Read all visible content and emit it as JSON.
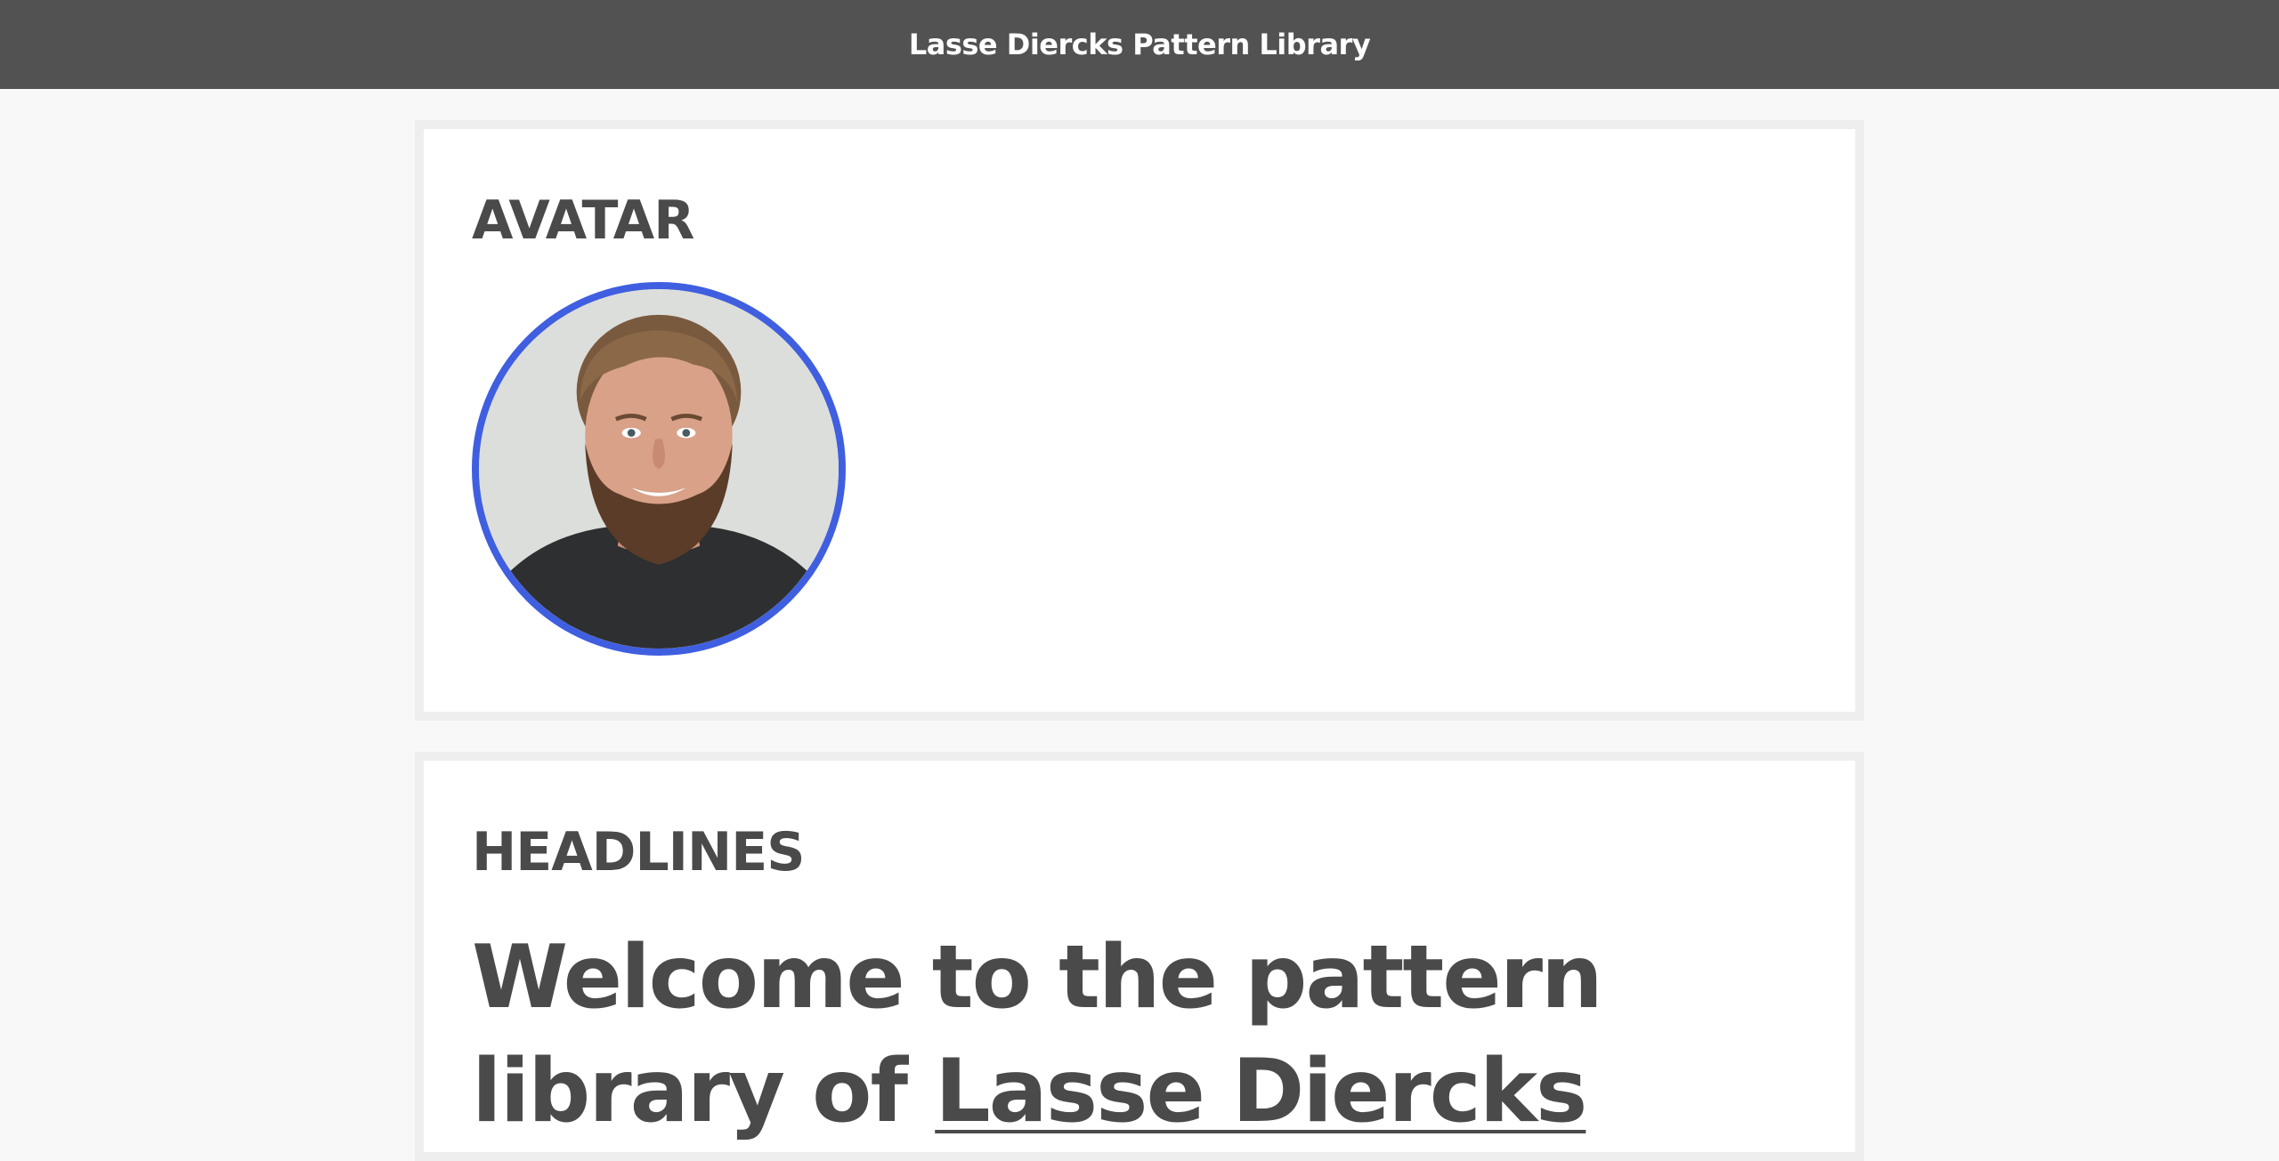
{
  "header": {
    "title": "Lasse Diercks Pattern Library"
  },
  "avatar_section": {
    "title": "AVATAR",
    "avatar_alt": "Lasse Diercks",
    "border_color": "#3f5fe0"
  },
  "headlines_section": {
    "title": "HEADLINES",
    "headline_prefix": "Welcome to the pattern library of ",
    "headline_link": "Lasse Diercks"
  },
  "colors": {
    "header_bg": "#525252",
    "page_bg": "#f8f8f8",
    "card_bg": "#ffffff",
    "card_border": "#eeeeee",
    "text": "#4a4a4a"
  }
}
